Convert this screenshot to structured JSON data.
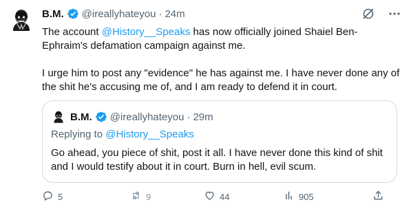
{
  "tweet": {
    "author": {
      "display_name": "B.M.",
      "handle": "@ireallyhateyou",
      "verified": true
    },
    "separator": "·",
    "time": "24m",
    "body": {
      "p1_before": "The account ",
      "p1_mention": "@History__Speaks",
      "p1_after": " has now officially joined Shaiel Ben-Ephraim's defamation campaign against me.",
      "p2": "I urge him to post any \"evidence\" he has against me. I have never done any of the shit he's accusing me of, and I am ready to defend it in court."
    },
    "quote": {
      "display_name": "B.M.",
      "handle": "@ireallyhateyou",
      "separator": "·",
      "time": "29m",
      "replying_prefix": "Replying to ",
      "replying_to": "@History__Speaks",
      "text": "Go ahead, you piece of shit, post it all. I have never done this kind of shit and I would testify about it in court. Burn in hell, evil scum."
    },
    "stats": {
      "replies": "5",
      "retweets": "9",
      "likes": "44",
      "views": "905"
    },
    "icons": {
      "verified": "verified-badge-icon",
      "grok": "grok-icon",
      "more": "more-icon",
      "reply": "reply-icon",
      "retweet": "retweet-icon",
      "like": "heart-icon",
      "views": "views-icon",
      "share": "share-icon"
    },
    "colors": {
      "accent": "#1d9bf0",
      "muted": "#536471",
      "border": "#cfd9de"
    }
  }
}
